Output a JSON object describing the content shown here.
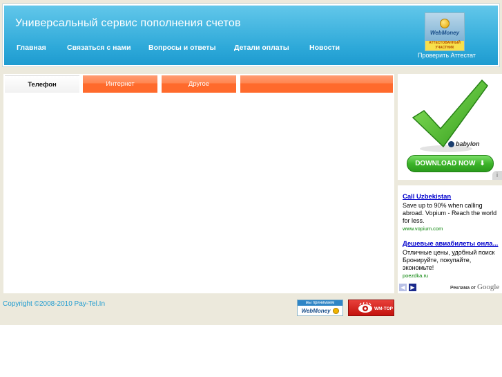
{
  "header": {
    "title": "Универсальный сервис пополнения счетов",
    "nav": [
      "Главная",
      "Связаться с нами",
      "Вопросы и ответы",
      "Детали оплаты",
      "Новости"
    ],
    "webmoney_badge": {
      "brand": "WebMoney",
      "status_line1": "АТТЕСТОВАННЫЙ",
      "status_line2": "УЧАСТНИК"
    },
    "attest_link": "Проверить Аттестат"
  },
  "tabs": [
    {
      "label": "Телефон",
      "active": true
    },
    {
      "label": "Интернет",
      "active": false
    },
    {
      "label": "Другое",
      "active": false
    },
    {
      "label": "",
      "active": false
    }
  ],
  "ad_top": {
    "brand": "babylon",
    "button": "DOWNLOAD NOW",
    "info_icon": "i"
  },
  "ad_bottom": {
    "ads": [
      {
        "title": "Call Uzbekistan",
        "text": "Save up to 90% when calling abroad. Vopium - Reach the world for less.",
        "url": "www.vopium.com"
      },
      {
        "title": "Дешевые авиабилеты онла...",
        "text": "Отличные цены, удобный поиск Бронируйте, покупайте, экономьте!",
        "url": "poezdka.ru"
      }
    ],
    "ads_by": "Реклама от",
    "google": "Google"
  },
  "footer": {
    "copyright": "Copyright ©2008-2010 Pay-Tel.In",
    "accept_label": "мы принимаем",
    "accept_brand": "WebMoney",
    "wm_top": "WM-TOP"
  },
  "colors": {
    "header_blue": "#2ea9d9",
    "tab_orange": "#ff6a2c",
    "page_bg": "#ece9dc",
    "link_blue": "#0000cc",
    "url_green": "#008000"
  }
}
